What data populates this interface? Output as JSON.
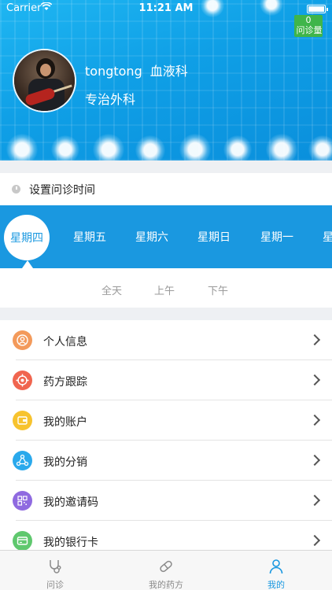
{
  "status_bar": {
    "carrier": "Carrier",
    "time": "11:21 AM"
  },
  "header": {
    "consult_count": "0",
    "consult_label": "问诊量",
    "doctor_name": "tongtong",
    "department": "血液科",
    "specialty": "专治外科"
  },
  "schedule": {
    "title": "设置问诊时间",
    "days": [
      "星期四",
      "星期五",
      "星期六",
      "星期日",
      "星期一",
      "星"
    ],
    "selected_day": "星期四",
    "periods": [
      "全天",
      "上午",
      "下午"
    ]
  },
  "menu": {
    "items": [
      {
        "label": "个人信息",
        "icon": "person-icon",
        "color": "#f39a5b"
      },
      {
        "label": "药方跟踪",
        "icon": "target-icon",
        "color": "#f0654f"
      },
      {
        "label": "我的账户",
        "icon": "wallet-icon",
        "color": "#f7c32e"
      },
      {
        "label": "我的分销",
        "icon": "share-network-icon",
        "color": "#2aa9ec"
      },
      {
        "label": "我的邀请码",
        "icon": "qr-code-icon",
        "color": "#8f6ae0"
      },
      {
        "label": "我的银行卡",
        "icon": "bank-card-icon",
        "color": "#5fc86e"
      }
    ]
  },
  "tabbar": {
    "tabs": [
      {
        "label": "问诊",
        "icon": "stethoscope-icon"
      },
      {
        "label": "我的药方",
        "icon": "pill-icon"
      },
      {
        "label": "我的",
        "icon": "user-icon"
      }
    ],
    "active_tab": "我的"
  },
  "colors": {
    "primary": "#1a98e0",
    "badge": "#3fb54a"
  }
}
